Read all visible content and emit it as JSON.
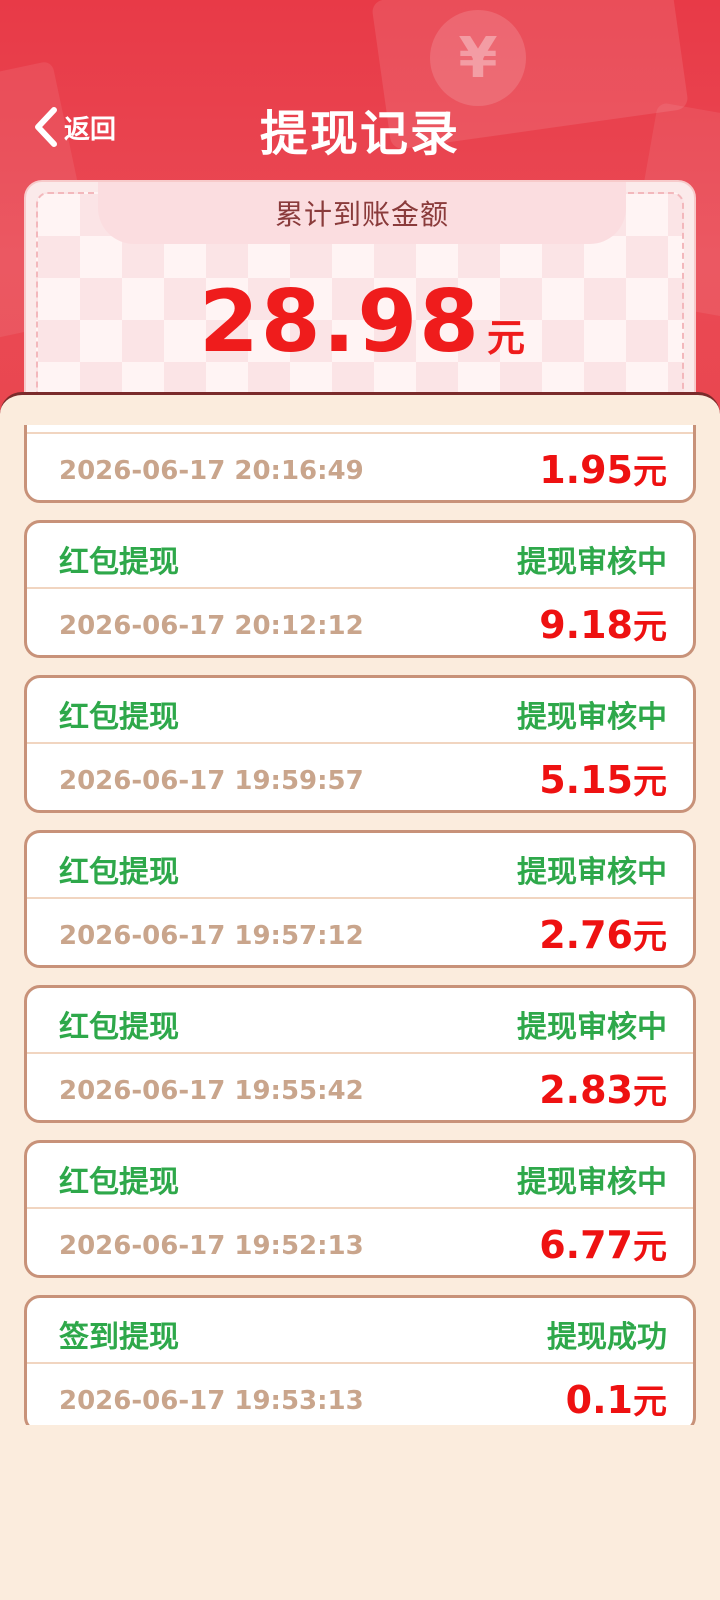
{
  "nav": {
    "back_label": "返回",
    "title": "提现记录"
  },
  "summary": {
    "label": "累计到账金额",
    "amount": "28.98",
    "unit": "元"
  },
  "records": [
    {
      "type": "",
      "status": "",
      "time": "2026-06-17 20:16:49",
      "amount": "1.95",
      "unit": "元"
    },
    {
      "type": "红包提现",
      "status": "提现审核中",
      "time": "2026-06-17 20:12:12",
      "amount": "9.18",
      "unit": "元"
    },
    {
      "type": "红包提现",
      "status": "提现审核中",
      "time": "2026-06-17 19:59:57",
      "amount": "5.15",
      "unit": "元"
    },
    {
      "type": "红包提现",
      "status": "提现审核中",
      "time": "2026-06-17 19:57:12",
      "amount": "2.76",
      "unit": "元"
    },
    {
      "type": "红包提现",
      "status": "提现审核中",
      "time": "2026-06-17 19:55:42",
      "amount": "2.83",
      "unit": "元"
    },
    {
      "type": "红包提现",
      "status": "提现审核中",
      "time": "2026-06-17 19:52:13",
      "amount": "6.77",
      "unit": "元"
    },
    {
      "type": "签到提现",
      "status": "提现成功",
      "time": "2026-06-17 19:53:13",
      "amount": "0.1",
      "unit": "元"
    }
  ],
  "colors": {
    "primary_red": "#e83a47",
    "amount_red": "#ee1111",
    "status_green": "#2ea84a",
    "panel_bg": "#fbecdd"
  },
  "icons": {
    "back": "chevron-left-icon",
    "decor": "yuan-coin-icon"
  }
}
